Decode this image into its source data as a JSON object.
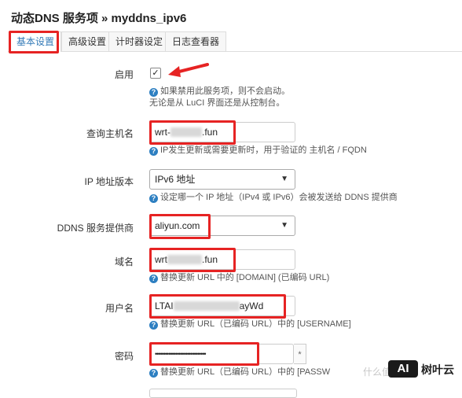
{
  "page": {
    "title": "动态DNS 服务项 » myddns_ipv6"
  },
  "tabs": [
    {
      "label": "基本设置",
      "active": true
    },
    {
      "label": "高级设置",
      "active": false
    },
    {
      "label": "计时器设定",
      "active": false
    },
    {
      "label": "日志查看器",
      "active": false
    }
  ],
  "form": {
    "enable": {
      "label": "启用",
      "checked": true,
      "check_glyph": "✓",
      "help_line1": "如果禁用此服务项，则不会启动。",
      "help_line2": "无论是从 LuCI 界面还是从控制台。"
    },
    "lookup_host": {
      "label": "查询主机名",
      "value_prefix": "wrt-",
      "value_suffix": ".fun",
      "help": "IP发生更新或需要更新时，用于验证的 主机名 / FQDN"
    },
    "ip_version": {
      "label": "IP 地址版本",
      "value": "IPv6 地址",
      "help": "设定哪一个 IP 地址（IPv4 或 IPv6）会被发送给 DDNS 提供商"
    },
    "provider": {
      "label": "DDNS 服务提供商",
      "value": "aliyun.com"
    },
    "domain": {
      "label": "域名",
      "value_prefix": "wrt",
      "value_suffix": ".fun",
      "help": "替换更新 URL 中的 [DOMAIN] (已编码 URL)"
    },
    "username": {
      "label": "用户名",
      "value_prefix": "LTAI",
      "value_suffix": "ayWd",
      "help": "替换更新 URL（已编码 URL）中的 [USERNAME]"
    },
    "password": {
      "label": "密码",
      "value": "••••••••••••••••••••••••••••••",
      "reveal_glyph": "*",
      "help": "替换更新 URL（已编码 URL）中的 [PASSW"
    }
  },
  "help_icon": {
    "glyph": "?",
    "name": "help-icon"
  },
  "watermark": {
    "badge": "AI",
    "text": "树叶云",
    "faint_text": "什么值得买",
    "colors": {
      "badge_bg": "#1a1a1a",
      "badge_fg": "#ffffff"
    }
  },
  "colors": {
    "highlight": "#e62323",
    "link_blue": "#337ab7",
    "help_icon": "#2d7fc1"
  }
}
